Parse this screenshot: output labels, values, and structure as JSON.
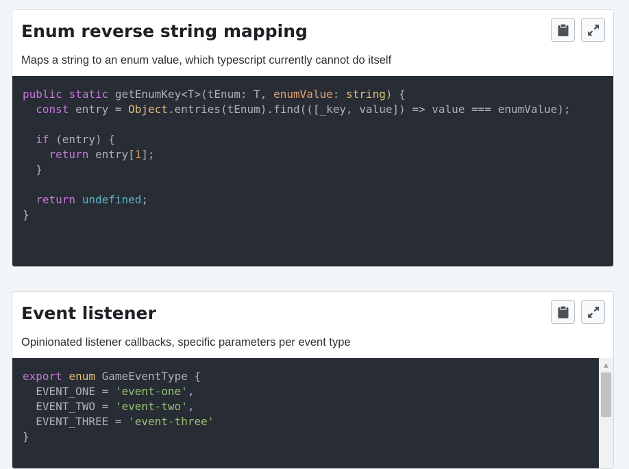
{
  "snippets": [
    {
      "title": "Enum reverse string mapping",
      "description": "Maps a string to an enum value, which typescript currently cannot do itself",
      "copy_icon": "clipboard-icon",
      "expand_icon": "expand-arrows-icon",
      "code_lines": [
        [
          [
            "kw",
            "public"
          ],
          [
            "p",
            " "
          ],
          [
            "kw",
            "static"
          ],
          [
            "p",
            " getEnumKey<T>(tEnum: T, "
          ],
          [
            "pa",
            "enumValue"
          ],
          [
            "p",
            ": "
          ],
          [
            "ty",
            "string"
          ],
          [
            "p",
            ") {"
          ]
        ],
        [
          [
            "p",
            "  "
          ],
          [
            "kw",
            "const"
          ],
          [
            "p",
            " entry = "
          ],
          [
            "ty",
            "Object"
          ],
          [
            "p",
            ".entries(tEnum).find(([_key, value]) => value === enumValue);"
          ]
        ],
        [
          [
            "p",
            ""
          ]
        ],
        [
          [
            "p",
            "  "
          ],
          [
            "kw",
            "if"
          ],
          [
            "p",
            " (entry) {"
          ]
        ],
        [
          [
            "p",
            "    "
          ],
          [
            "kw",
            "return"
          ],
          [
            "p",
            " entry["
          ],
          [
            "nu",
            "1"
          ],
          [
            "p",
            "];"
          ]
        ],
        [
          [
            "p",
            "  }"
          ]
        ],
        [
          [
            "p",
            ""
          ]
        ],
        [
          [
            "p",
            "  "
          ],
          [
            "kw",
            "return"
          ],
          [
            "p",
            " "
          ],
          [
            "bi",
            "undefined"
          ],
          [
            "p",
            ";"
          ]
        ],
        [
          [
            "p",
            "}"
          ]
        ]
      ]
    },
    {
      "title": "Event listener",
      "description": "Opinionated listener callbacks, specific parameters per event type",
      "copy_icon": "clipboard-icon",
      "expand_icon": "expand-arrows-icon",
      "code_lines": [
        [
          [
            "kw",
            "export"
          ],
          [
            "p",
            " "
          ],
          [
            "ty",
            "enum"
          ],
          [
            "p",
            " GameEventType {"
          ]
        ],
        [
          [
            "p",
            "  EVENT_ONE = "
          ],
          [
            "st",
            "'event-one'"
          ],
          [
            "p",
            ","
          ]
        ],
        [
          [
            "p",
            "  EVENT_TWO = "
          ],
          [
            "st",
            "'event-two'"
          ],
          [
            "p",
            ","
          ]
        ],
        [
          [
            "p",
            "  EVENT_THREE = "
          ],
          [
            "st",
            "'event-three'"
          ]
        ],
        [
          [
            "p",
            "}"
          ]
        ]
      ]
    }
  ],
  "colors": {
    "code_background": "#282c34",
    "keyword": "#c678dd",
    "type": "#e5c07b",
    "string": "#98c379",
    "number": "#d19a66",
    "builtin": "#56b6c2"
  }
}
